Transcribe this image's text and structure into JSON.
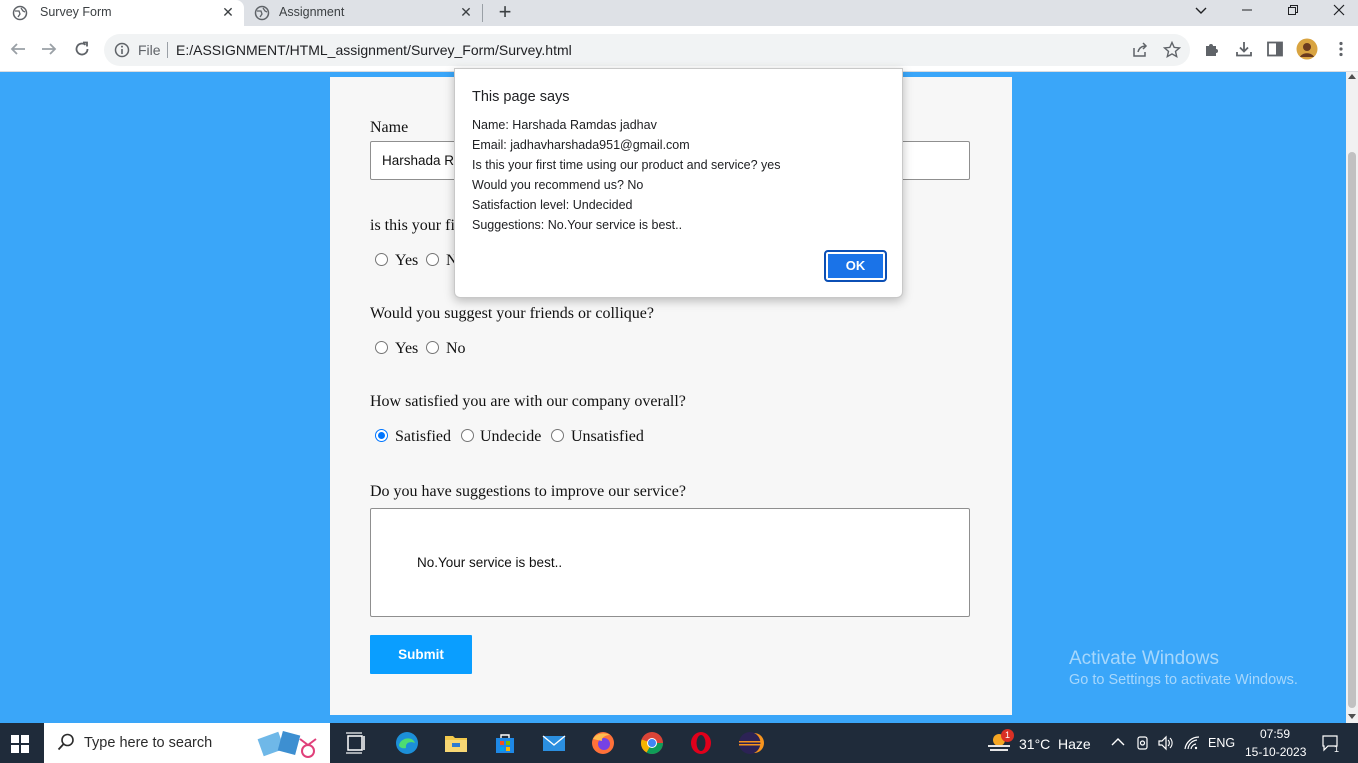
{
  "browser": {
    "tabs": [
      {
        "title": "Survey Form",
        "active": true,
        "icon": "globe-icon"
      },
      {
        "title": "Assignment",
        "active": false,
        "icon": "globe-icon"
      }
    ],
    "omnibox": {
      "security_label": "File",
      "url": "E:/ASSIGNMENT/HTML_assignment/Survey_Form/Survey.html"
    }
  },
  "form": {
    "name_label": "Name",
    "name_value_visible": "Harshada R",
    "q1_label_visible": "is this your fi",
    "q1_options": [
      "Yes",
      "N"
    ],
    "q2_label": "Would you suggest your friends or collique?",
    "q2_options": [
      "Yes",
      "No"
    ],
    "q3_label": "How satisfied you are with our company overall?",
    "q3_options": [
      "Satisfied",
      "Undecide",
      "Unsatisfied"
    ],
    "q3_selected": "Satisfied",
    "q4_label": "Do you have suggestions to improve our service?",
    "q4_value": "No.Your service is best..",
    "submit_label": "Submit"
  },
  "dialog": {
    "title": "This page says",
    "lines": [
      "Name: Harshada Ramdas jadhav",
      "Email: jadhavharshada951@gmail.com",
      "Is this your first time using our product and service? yes",
      "Would you recommend us? No",
      "Satisfaction level: Undecided",
      "Suggestions: No.Your service is best.."
    ],
    "ok_label": "OK"
  },
  "watermark": {
    "line1": "Activate Windows",
    "line2": "Go to Settings to activate Windows."
  },
  "taskbar": {
    "search_placeholder": "Type here to search",
    "weather_temp": "31°C",
    "weather_desc": "Haze",
    "weather_badge": "1",
    "language": "ENG",
    "time": "07:59",
    "date": "15-10-2023",
    "notification_count": "1"
  },
  "colors": {
    "page_background": "#3aa6f9",
    "submit_button": "#0a9eff",
    "dialog_ok": "#1a73e8",
    "taskbar": "#1f2b3a"
  }
}
